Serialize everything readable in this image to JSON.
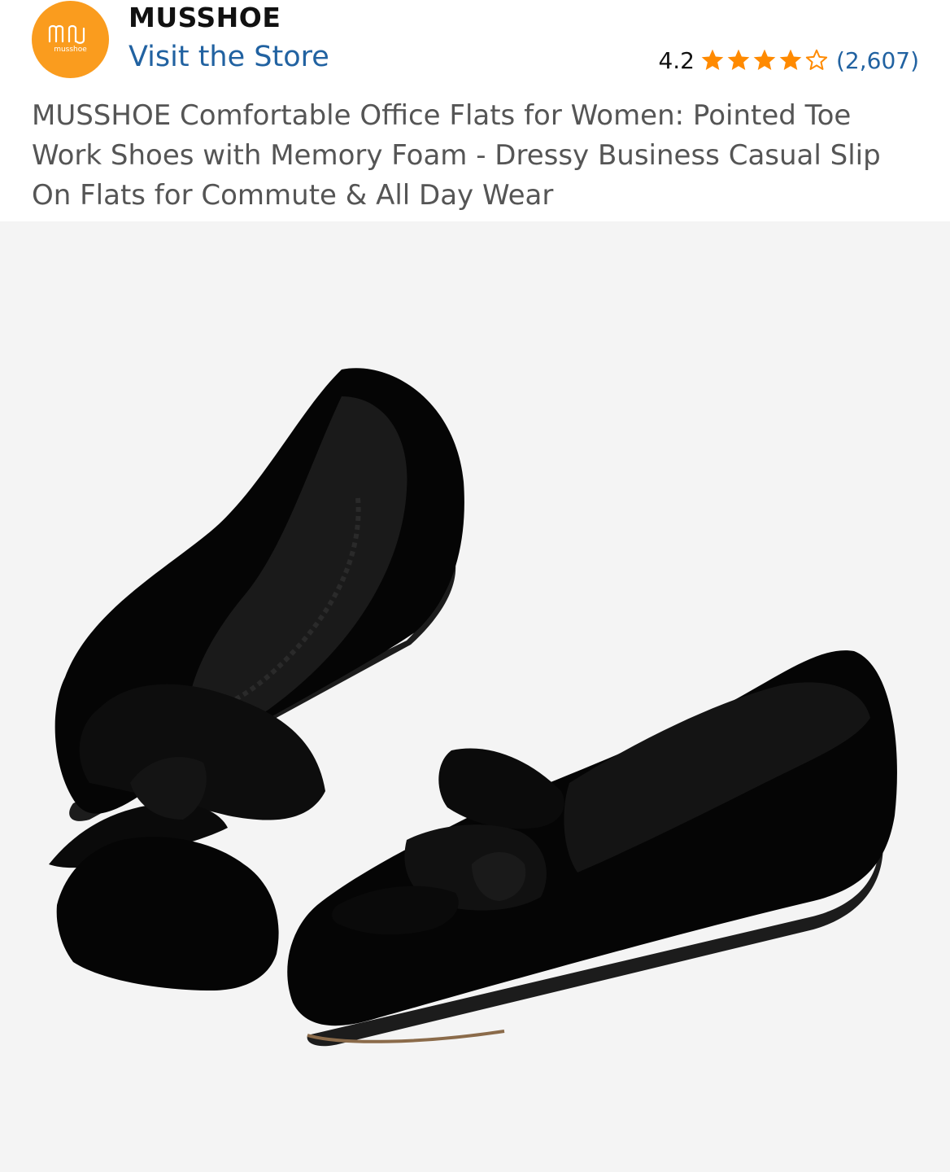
{
  "store": {
    "logo_icon": "musshoe-logo-icon",
    "logo_text": "musshoe",
    "name": "MUSSHOE",
    "visit_label": "Visit the Store"
  },
  "rating": {
    "value": "4.2",
    "stars_filled": 4,
    "stars_total": 5,
    "count": "(2,607)"
  },
  "product": {
    "title": "MUSSHOE Comfortable Office Flats for Women: Pointed Toe Work Shoes with Memory Foam - Dressy Business Casual Slip On Flats for Commute & All Day Wear",
    "image_alt": "black-suede-pointed-toe-flats-with-bow"
  },
  "colors": {
    "logo_bg": "#fa9c1e",
    "link": "#2162a1",
    "star": "#ff8a00",
    "image_bg": "#f4f4f4"
  }
}
